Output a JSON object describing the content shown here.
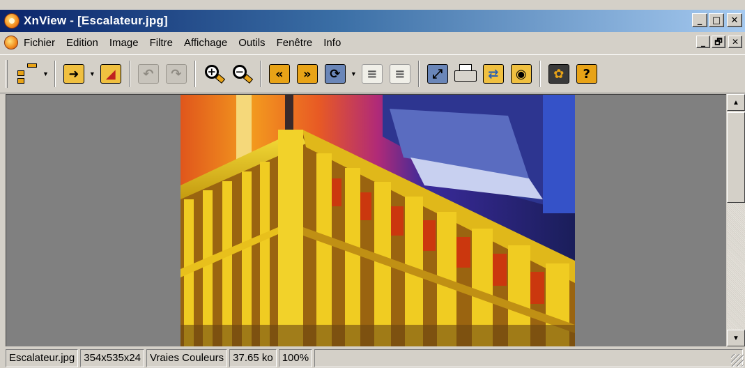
{
  "window": {
    "title": "XnView - [Escalateur.jpg]",
    "buttons": {
      "minimize": "_",
      "maximize": "□",
      "close": "✕"
    }
  },
  "menubar": {
    "items": [
      "Fichier",
      "Edition",
      "Image",
      "Filtre",
      "Affichage",
      "Outils",
      "Fenêtre",
      "Info"
    ],
    "mdi_buttons": {
      "minimize": "_",
      "restore": "🗗",
      "close": "✕"
    }
  },
  "toolbar": {
    "buttons": [
      {
        "name": "browser-tree",
        "icon": "tree-icon",
        "dropdown": true
      },
      {
        "name": "open",
        "icon": "open-folder-icon",
        "dropdown": true
      },
      {
        "name": "save",
        "icon": "save-icon"
      },
      {
        "name": "undo",
        "icon": "undo-icon",
        "disabled": true
      },
      {
        "name": "redo",
        "icon": "redo-icon",
        "disabled": true
      },
      {
        "name": "zoom-in",
        "icon": "zoom-in-icon",
        "glyph": "+"
      },
      {
        "name": "zoom-out",
        "icon": "zoom-out-icon",
        "glyph": "−"
      },
      {
        "name": "previous",
        "icon": "previous-icon",
        "glyph": "«"
      },
      {
        "name": "next",
        "icon": "next-icon",
        "glyph": "»"
      },
      {
        "name": "slideshow",
        "icon": "refresh-icon",
        "glyph": "⟳",
        "dropdown": true
      },
      {
        "name": "page-prev",
        "icon": "page-prev-icon",
        "glyph": "≡",
        "disabled": true
      },
      {
        "name": "page-next",
        "icon": "page-next-icon",
        "glyph": "≡",
        "disabled": true
      },
      {
        "name": "fullscreen",
        "icon": "fullscreen-icon",
        "glyph": "⤢"
      },
      {
        "name": "print",
        "icon": "printer-icon"
      },
      {
        "name": "convert",
        "icon": "convert-icon",
        "glyph": "⇄"
      },
      {
        "name": "capture",
        "icon": "camera-icon",
        "glyph": "◉"
      },
      {
        "name": "options",
        "icon": "gear-icon",
        "glyph": "✿"
      },
      {
        "name": "help",
        "icon": "help-icon",
        "glyph": "?"
      }
    ]
  },
  "statusbar": {
    "filename": "Escalateur.jpg",
    "dimensions": "354x535x24",
    "color_mode": "Vraies Couleurs",
    "file_size": "37.65 ko",
    "zoom": "100%"
  },
  "colors": {
    "titlebar_start": "#0a246a",
    "titlebar_end": "#a6caf0",
    "chrome": "#d4d0c8",
    "viewer_bg": "#808080",
    "icon_accent": "#e8a317"
  }
}
